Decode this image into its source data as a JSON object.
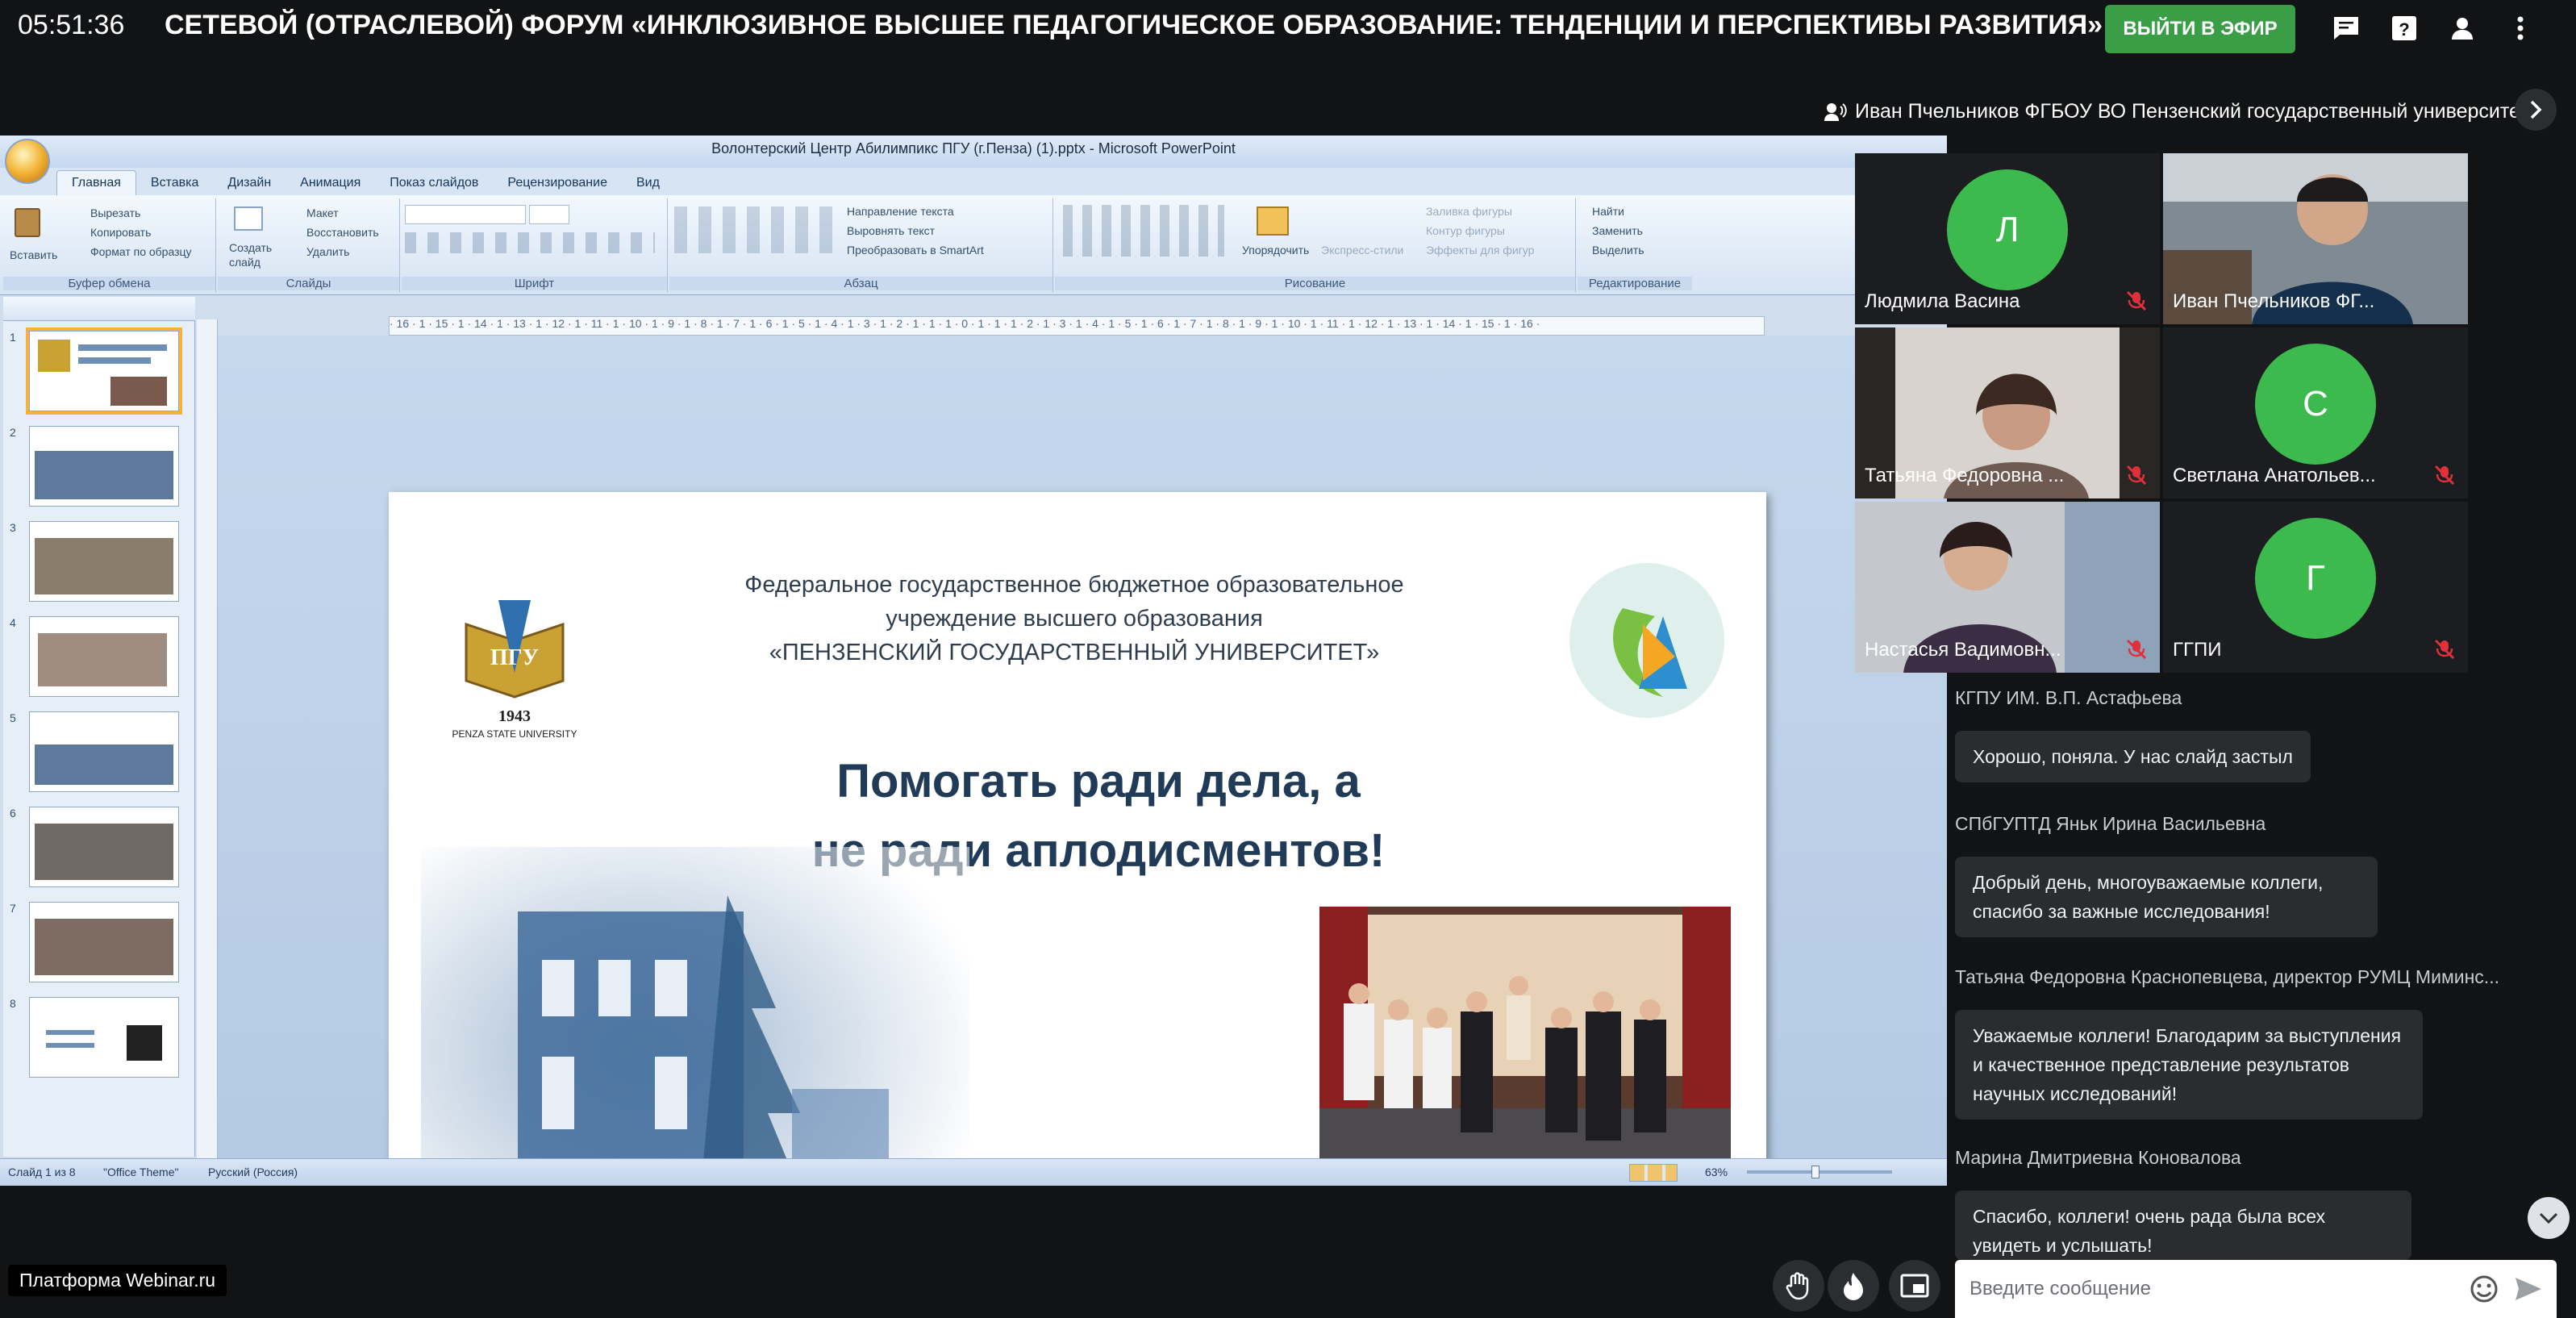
{
  "topbar": {
    "clock": "05:51:36",
    "event_title": "СЕТЕВОЙ (ОТРАСЛЕВОЙ) ФОРУМ «ИНКЛЮЗИВНОЕ ВЫСШЕЕ ПЕДАГОГИЧЕСКОЕ ОБРАЗОВАНИЕ: ТЕНДЕНЦИИ И ПЕРСПЕКТИВЫ РАЗВИТИЯ»",
    "go_live_label": "ВЫЙТИ В ЭФИР",
    "icons": [
      "chat-icon",
      "help-icon",
      "user-icon",
      "more-vert-icon"
    ],
    "accent_color": "#3a9e47"
  },
  "presenter": {
    "name": "Иван Пчельников ФГБОУ ВО Пензенский государственный университет"
  },
  "ppt": {
    "window_title": "Волонтерский Центр Абилимпикс ПГУ (г.Пенза) (1).pptx - Microsoft PowerPoint",
    "tabs": [
      "Главная",
      "Вставка",
      "Дизайн",
      "Анимация",
      "Показ слайдов",
      "Рецензирование",
      "Вид"
    ],
    "ribbon": {
      "clipboard": {
        "label": "Буфер обмена",
        "paste": "Вставить",
        "cut": "Вырезать",
        "copy": "Копировать",
        "format_painter": "Формат по образцу"
      },
      "slides": {
        "label": "Слайды",
        "new_slide": "Создать слайд",
        "layout": "Макет",
        "reset": "Восстановить",
        "delete": "Удалить"
      },
      "font": {
        "label": "Шрифт"
      },
      "paragraph": {
        "label": "Абзац",
        "text_direction": "Направление текста",
        "align_text": "Выровнять текст",
        "smartart": "Преобразовать в SmartArt"
      },
      "drawing": {
        "label": "Рисование",
        "arrange": "Упорядочить",
        "quick_styles": "Экспресс-стили",
        "shape_fill": "Заливка фигуры",
        "shape_outline": "Контур фигуры",
        "shape_effects": "Эффекты для фигур"
      },
      "editing": {
        "label": "Редактирование",
        "find": "Найти",
        "replace": "Заменить",
        "select": "Выделить"
      }
    },
    "thumb_numbers": [
      "1",
      "2",
      "3",
      "4",
      "5",
      "6",
      "7",
      "8"
    ],
    "ruler_text": "· 16 · 1 · 15 · 1 · 14 · 1 · 13 · 1 · 12 · 1 · 11 · 1 · 10 · 1 · 9 · 1 · 8 · 1 · 7 · 1 · 6 · 1 · 5 · 1 · 4 · 1 · 3 · 1 · 2 · 1 · 1 · 1 · 0 · 1 · 1 · 1 · 2 · 1 · 3 · 1 · 4 · 1 · 5 · 1 · 6 · 1 · 7 · 1 · 8 · 1 · 9 · 1 · 10 · 1 · 11 · 1 · 12 · 1 · 13 · 1 · 14 · 1 · 15 · 1 · 16 ·",
    "slide": {
      "header_line1": "Федеральное государственное бюджетное образовательное",
      "header_line2": "учреждение высшего образования",
      "header_line3": "«ПЕНЗЕНСКИЙ ГОСУДАРСТВЕННЫЙ УНИВЕРСИТЕТ»",
      "quote_line1": "Помогать ради дела, а",
      "quote_line2": "не ради аплодисментов!",
      "logo_year": "1943",
      "logo_text": "PENZA STATE UNIVERSITY"
    },
    "status": {
      "slide_of": "Слайд 1 из 8",
      "theme": "\"Office Theme\"",
      "language": "Русский (Россия)",
      "zoom": "63%"
    }
  },
  "participants": [
    {
      "name": "Людмила Васина",
      "initial": "Л",
      "video": false,
      "muted": true
    },
    {
      "name": "Иван Пчельников ФГ...",
      "initial": "",
      "video": true,
      "muted": false,
      "active": true
    },
    {
      "name": "Татьяна Федоровна ...",
      "initial": "",
      "video": true,
      "muted": true
    },
    {
      "name": "Светлана Анатольев...",
      "initial": "С",
      "video": false,
      "muted": true
    },
    {
      "name": "Настасья Вадимовн...",
      "initial": "",
      "video": true,
      "muted": true
    },
    {
      "name": "ГГПИ",
      "initial": "Г",
      "video": false,
      "muted": true
    }
  ],
  "chat": {
    "messages": [
      {
        "sender": "КГПУ ИМ. В.П. Астафьева",
        "text": "Хорошо, поняла. У нас слайд застыл"
      },
      {
        "sender": "СПбГУПТД Яньк Ирина Васильевна",
        "text": "Добрый день, многоуважаемые коллеги, спасибо за важные исследования!"
      },
      {
        "sender": "Татьяна Федоровна Краснопевцева, директор РУМЦ Миминс...",
        "text": "Уважаемые коллеги! Благодарим за выступления и качественное представление результатов научных исследований!"
      },
      {
        "sender": "Марина Дмитриевна Коновалова",
        "text": "Спасибо, коллеги! очень рада была всех увидеть и услышать!"
      }
    ],
    "input_placeholder": "Введите сообщение"
  },
  "bottom": {
    "platform_label": "Платформа Webinar.ru",
    "buttons": [
      "raise-hand-icon",
      "fire-icon",
      "screen-share-icon"
    ]
  }
}
